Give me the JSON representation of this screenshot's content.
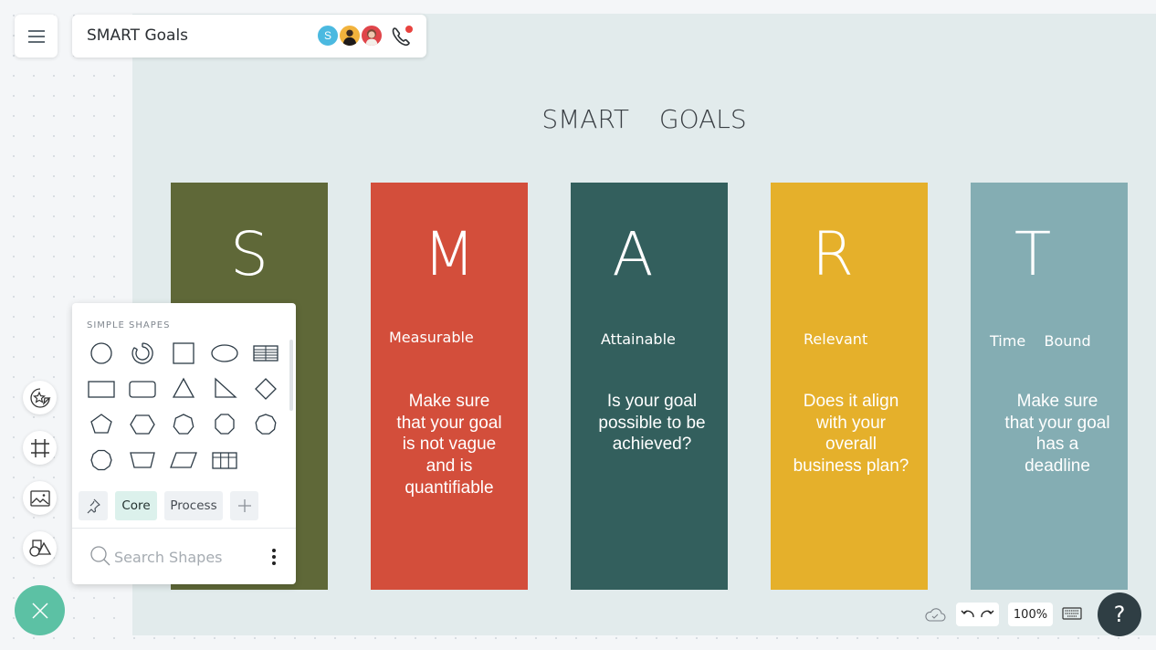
{
  "header": {
    "document_title": "SMART Goals",
    "menu_icon": "hamburger-icon",
    "collaborators": [
      {
        "type": "initial",
        "label": "S",
        "color": "#4bb9e0"
      },
      {
        "type": "photo",
        "color": "#f2b33d"
      },
      {
        "type": "photo",
        "color": "#e0454a"
      }
    ],
    "call_icon": "phone-icon",
    "call_indicator_color": "#e8433f"
  },
  "board": {
    "title": "SMART GOALS",
    "cards": [
      {
        "letter": "S",
        "label": "",
        "description": "",
        "color": "#5f6838"
      },
      {
        "letter": "M",
        "label": "Measurable",
        "description": "Make sure that your goal is not vague and is quantifiable",
        "color": "#d34e3b"
      },
      {
        "letter": "A",
        "label": "Attainable",
        "description": "Is your goal possible to be achieved?",
        "color": "#335f5d"
      },
      {
        "letter": "R",
        "label": "Relevant",
        "description": "Does it align with your overall business plan?",
        "color": "#e5b02b"
      },
      {
        "letter": "T",
        "label": "Time    Bound",
        "description": "Make sure that your goal has a deadline",
        "color": "#84adb3"
      }
    ]
  },
  "left_toolbar": {
    "buttons": [
      {
        "name": "sticker-tool",
        "icon": "star-sticker-icon"
      },
      {
        "name": "frame-tool",
        "icon": "frame-icon"
      },
      {
        "name": "image-tool",
        "icon": "image-icon"
      },
      {
        "name": "shapes-tool",
        "icon": "shapes-icon"
      }
    ],
    "close_icon": "close-icon",
    "accent": "#5cc1a4"
  },
  "shapes_panel": {
    "heading": "SIMPLE SHAPES",
    "shapes": [
      "circle",
      "donut",
      "square",
      "ellipse",
      "table-lines",
      "rectangle",
      "rounded-rectangle",
      "triangle",
      "right-triangle",
      "diamond",
      "pentagon",
      "hexagon",
      "heptagon",
      "octagon",
      "nonagon",
      "decagon",
      "trapezoid",
      "parallelogram",
      "grid-table"
    ],
    "tabs": [
      {
        "label": "Core",
        "active": true
      },
      {
        "label": "Process",
        "active": false
      }
    ],
    "pin_icon": "pin-icon",
    "add_icon": "plus-icon",
    "search_placeholder": "Search Shapes",
    "more_icon": "more-vertical-icon"
  },
  "bottom_bar": {
    "save_status_icon": "cloud-check-icon",
    "undo_icon": "undo-icon",
    "redo_icon": "redo-icon",
    "zoom_level": "100%",
    "keyboard_icon": "keyboard-icon",
    "help_label": "?"
  }
}
